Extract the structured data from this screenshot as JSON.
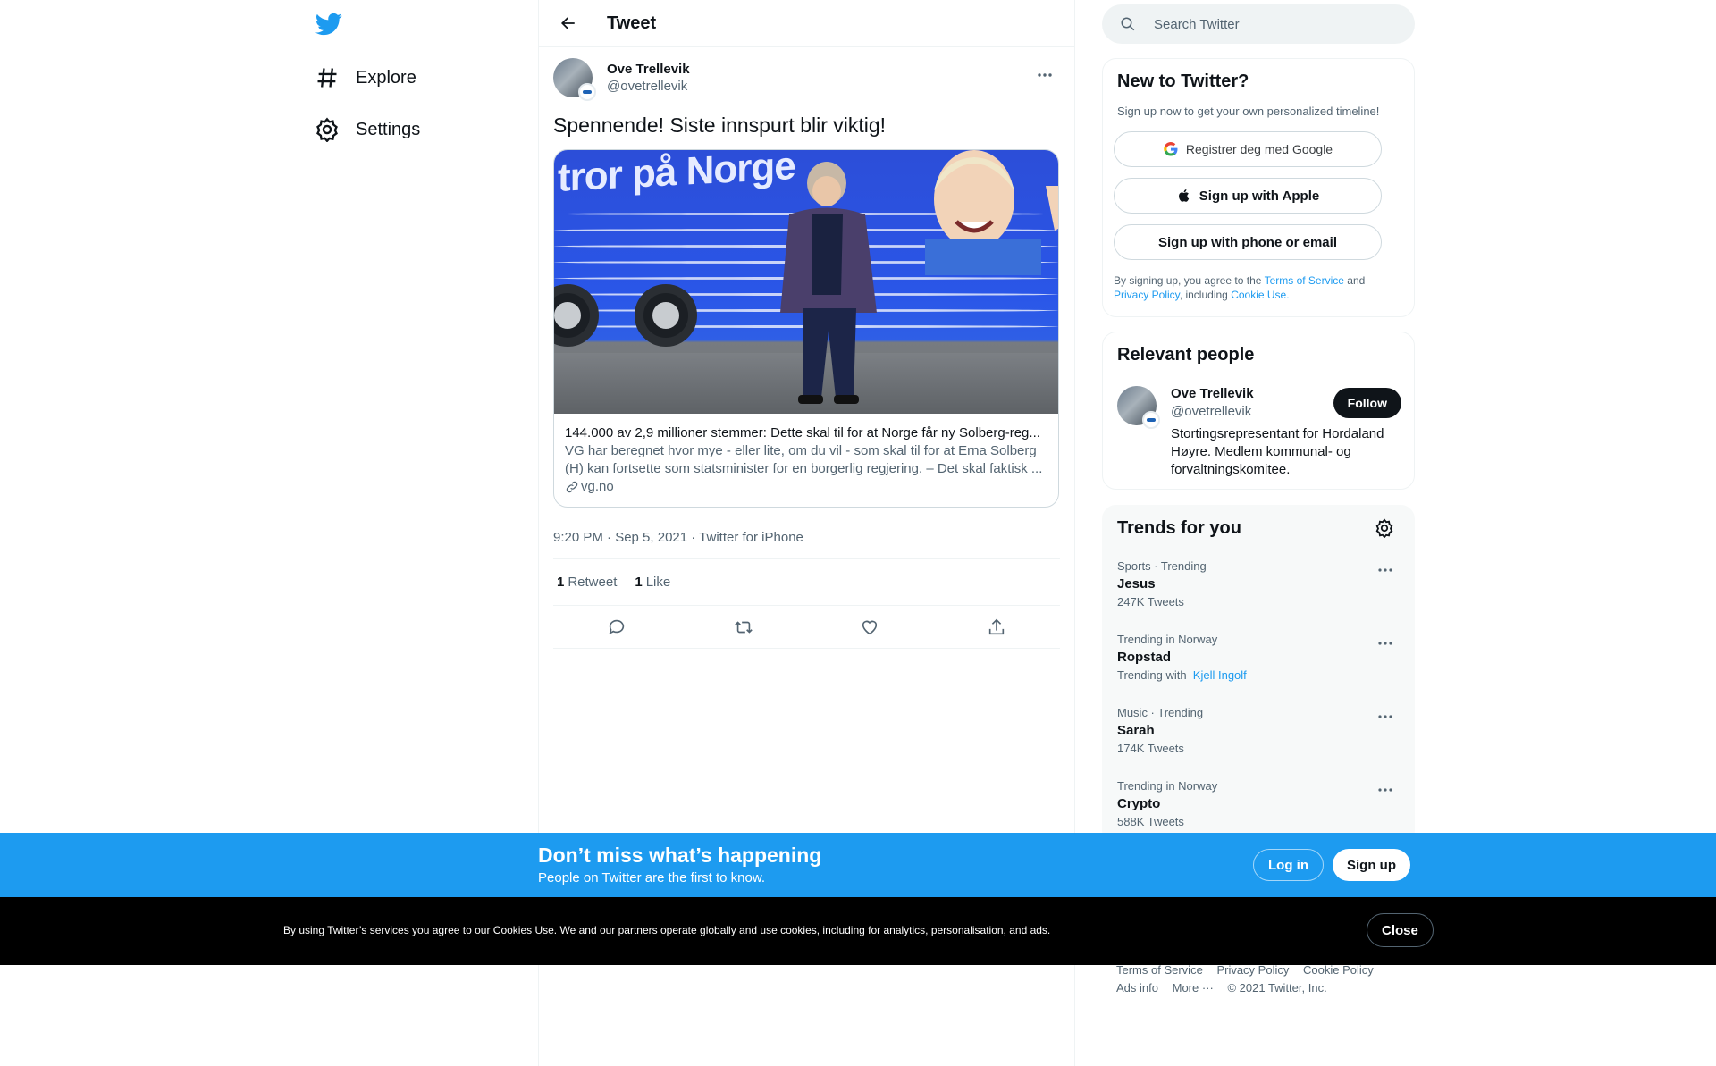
{
  "nav": {
    "logo": "twitter-bird-icon",
    "items": [
      {
        "label": "Explore",
        "icon": "hashtag-icon"
      },
      {
        "label": "Settings",
        "icon": "gear-icon"
      }
    ]
  },
  "header": {
    "title": "Tweet"
  },
  "tweet": {
    "author_name": "Ove Trellevik",
    "author_handle": "@ovetrellevik",
    "text": "Spennende! Siste innspurt blir viktig!",
    "card": {
      "image_banner_text": "tror på Norge",
      "title": "144.000 av 2,9 millioner stemmer: Dette skal til for at Norge får ny Solberg-reg...",
      "description": "VG har beregnet hvor mye - eller lite, om du vil - som skal til for at Erna Solberg (H) kan fortsette som statsminister for en borgerlig regjering. – Det skal faktisk ...",
      "domain": "vg.no"
    },
    "meta": "9:20 PM · Sep 5, 2021 · Twitter for iPhone",
    "retweet_count": "1",
    "retweet_label": "Retweet",
    "like_count": "1",
    "like_label": "Like"
  },
  "search": {
    "placeholder": "Search Twitter"
  },
  "signup_panel": {
    "title": "New to Twitter?",
    "subtitle": "Sign up now to get your own personalized timeline!",
    "google_label": "Registrer deg med Google",
    "apple_label": "Sign up with Apple",
    "phone_label": "Sign up with phone or email",
    "terms_prefix": "By signing up, you agree to the",
    "terms_link": "Terms of Service",
    "terms_and": "and",
    "privacy_link": "Privacy Policy",
    "including": ", including",
    "cookie_link": "Cookie Use."
  },
  "people_panel": {
    "title": "Relevant people",
    "name": "Ove Trellevik",
    "handle": "@ovetrellevik",
    "follow_label": "Follow",
    "bio": "Stortingsrepresentant for Hordaland Høyre. Medlem kommunal- og forvaltningskomitee."
  },
  "trends_panel": {
    "title": "Trends for you",
    "items": [
      {
        "context": "Sports · Trending",
        "name": "Jesus",
        "count": "247K Tweets"
      },
      {
        "context": "Trending in Norway",
        "name": "Ropstad",
        "count_prefix": "Trending with",
        "count_link": "Kjell Ingolf"
      },
      {
        "context": "Music · Trending",
        "name": "Sarah",
        "count": "174K Tweets"
      },
      {
        "context": "Trending in Norway",
        "name": "Crypto",
        "count": "588K Tweets"
      }
    ]
  },
  "footer": {
    "links": [
      "Terms of Service",
      "Privacy Policy",
      "Cookie Policy",
      "Ads info",
      "More ···"
    ],
    "copyright": "© 2021 Twitter, Inc."
  },
  "promo": {
    "title": "Don’t miss what’s happening",
    "subtitle": "People on Twitter are the first to know.",
    "login_label": "Log in",
    "signup_label": "Sign up"
  },
  "cookie_bar": {
    "text": "By using Twitter’s services you agree to our Cookies Use. We and our partners operate globally and use cookies, including for analytics, personalisation, and ads.",
    "close_label": "Close"
  },
  "colors": {
    "accent": "#1d9bf0",
    "text": "#0f1419",
    "secondary": "#536471"
  }
}
